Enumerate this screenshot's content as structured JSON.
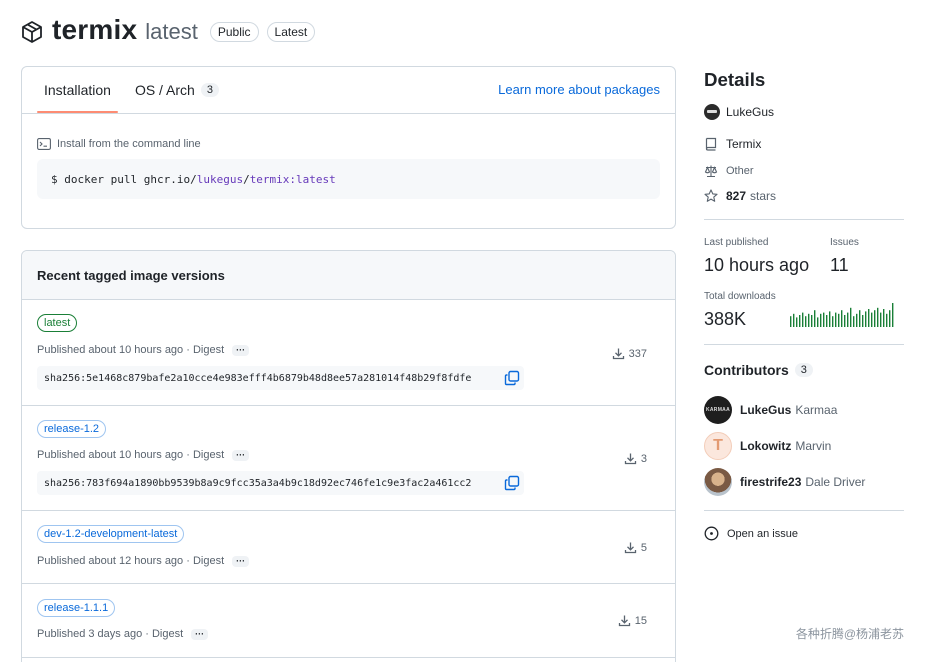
{
  "header": {
    "name": "termix",
    "tag": "latest",
    "badges": [
      "Public",
      "Latest"
    ]
  },
  "install": {
    "tabs": [
      {
        "label": "Installation",
        "active": true
      },
      {
        "label": "OS / Arch",
        "count": "3"
      }
    ],
    "learn_more": "Learn more about packages",
    "cmd_label": "Install from the command line",
    "cmd_prefix": "$ docker pull ghcr.io/",
    "cmd_owner": "lukegus",
    "cmd_sep": "/",
    "cmd_image": "termix:latest"
  },
  "versions": {
    "title": "Recent tagged image versions",
    "rows": [
      {
        "tag": "latest",
        "published": "Published about 10 hours ago · Digest",
        "digest": "sha256:5e1468c879bafe2a10cce4e983efff4b6879b48d8ee57a281014f48b29f8fdfe",
        "downloads": "337"
      },
      {
        "tag": "release-1.2",
        "published": "Published about 10 hours ago · Digest",
        "digest": "sha256:783f694a1890bb9539b8a9c9fcc35a3a4b9c18d92ec746fe1c9e3fac2a461cc2",
        "downloads": "3"
      },
      {
        "tag": "dev-1.2-development-latest",
        "published": "Published about 12 hours ago · Digest",
        "downloads": "5"
      },
      {
        "tag": "release-1.1.1",
        "published": "Published 3 days ago · Digest",
        "downloads": "15"
      }
    ],
    "dots": "···"
  },
  "details": {
    "title": "Details",
    "owner": "LukeGus",
    "repo": "Termix",
    "license": "Other",
    "stars_count": "827",
    "stars_label": "stars",
    "last_published_label": "Last published",
    "last_published_value": "10 hours ago",
    "issues_label": "Issues",
    "issues_value": "11",
    "downloads_label": "Total downloads",
    "downloads_value": "388K",
    "downloads_trend": [
      0.45,
      0.55,
      0.4,
      0.5,
      0.6,
      0.45,
      0.55,
      0.5,
      0.7,
      0.4,
      0.55,
      0.6,
      0.5,
      0.65,
      0.45,
      0.6,
      0.55,
      0.7,
      0.5,
      0.6,
      0.8,
      0.45,
      0.55,
      0.7,
      0.5,
      0.65,
      0.75,
      0.6,
      0.7,
      0.8,
      0.6,
      0.75,
      0.55,
      0.7,
      1.0
    ]
  },
  "contributors": {
    "title": "Contributors",
    "count": "3",
    "people": [
      {
        "login": "LukeGus",
        "name": "Karmaa",
        "avatar_text": "KARMAA"
      },
      {
        "login": "Lokowitz",
        "name": "Marvin",
        "avatar_text": "T"
      },
      {
        "login": "firestrife23",
        "name": "Dale Driver"
      }
    ]
  },
  "open_issue": "Open an issue",
  "watermark": "各种折腾@杨浦老苏",
  "colors": {
    "accent": "#0969da",
    "success": "#1a7f37",
    "tab_underline": "#fd8c73"
  }
}
